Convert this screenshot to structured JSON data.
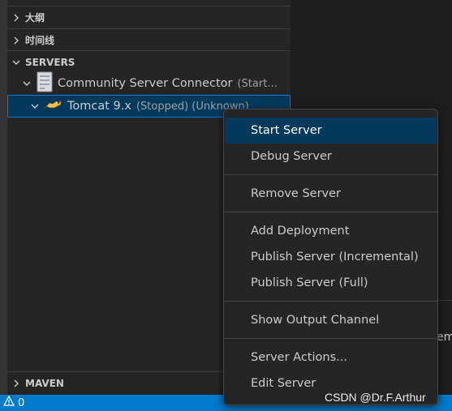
{
  "sidebar": {
    "sections": [
      {
        "label": "大纲",
        "expanded": false
      },
      {
        "label": "时间线",
        "expanded": false
      },
      {
        "label": "SERVERS",
        "expanded": true
      },
      {
        "label": "MAVEN",
        "expanded": false
      }
    ],
    "servers_tree": {
      "connector": {
        "label": "Community Server Connector",
        "desc": "(Start..."
      },
      "server": {
        "label": "Tomcat 9.x",
        "desc": "(Stopped) (Unknown)"
      }
    }
  },
  "context_menu": {
    "groups": [
      [
        "Start Server",
        "Debug Server"
      ],
      [
        "Remove Server"
      ],
      [
        "Add Deployment",
        "Publish Server (Incremental)",
        "Publish Server (Full)"
      ],
      [
        "Show Output Channel"
      ],
      [
        "Server Actions...",
        "Edit Server"
      ]
    ],
    "active_item": "Start Server"
  },
  "editor": {
    "cut_text": "em"
  },
  "statusbar": {
    "problems_count": "0"
  },
  "watermark": "CSDN @Dr.F.Arthur",
  "colors": {
    "accent": "#007acc",
    "selection": "#04395e",
    "focus_border": "#0078d4"
  }
}
